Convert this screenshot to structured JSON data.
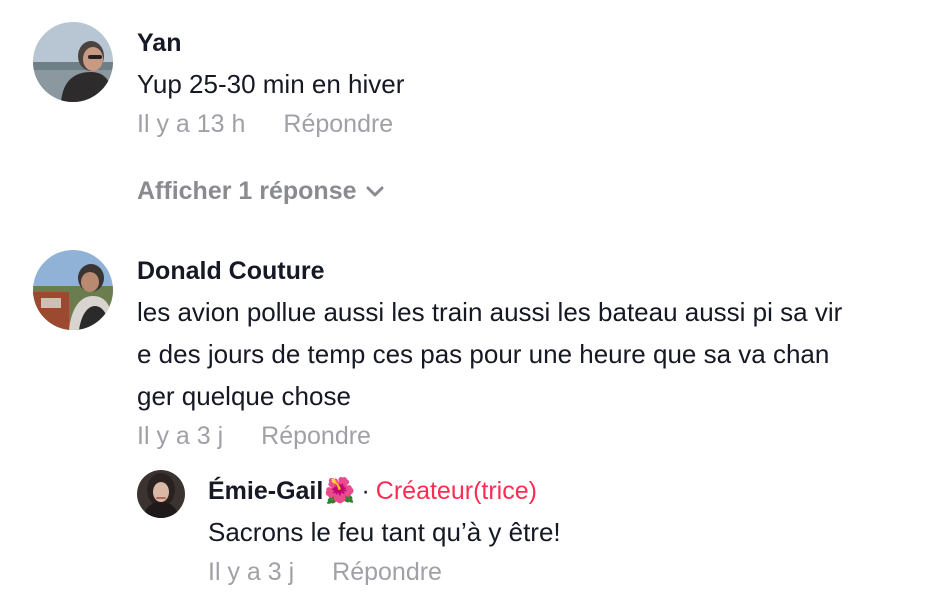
{
  "comments": [
    {
      "author": "Yan",
      "text_lines": [
        "Yup 25-30 min en hiver"
      ],
      "time": "Il y a 13 h",
      "reply_label": "Répondre",
      "show_replies_label": "Afficher 1 réponse"
    },
    {
      "author": "Donald Couture",
      "text_lines": [
        "les avion pollue aussi les train aussi les bateau aussi pi sa vir",
        "e des jours de temp ces pas pour une heure que sa va chan",
        "ger quelque chose"
      ],
      "time": "Il y a 3 j",
      "reply_label": "Répondre",
      "replies": [
        {
          "author": "Émie-Gail",
          "author_emoji": "🌺",
          "separator": "·",
          "badge": "Créateur(trice)",
          "text": "Sacrons le feu tant qu’à y être!",
          "time": "Il y a 3 j",
          "reply_label": "Répondre"
        }
      ]
    }
  ],
  "icons": {
    "show_replies": "chevron-down-icon",
    "reply_author_emoji": "hibiscus-icon"
  },
  "colors": {
    "text": "#161823",
    "muted": "#a0a1a7",
    "show_more": "#8a8b91",
    "creator_badge": "#fe2c55",
    "background": "#ffffff"
  }
}
